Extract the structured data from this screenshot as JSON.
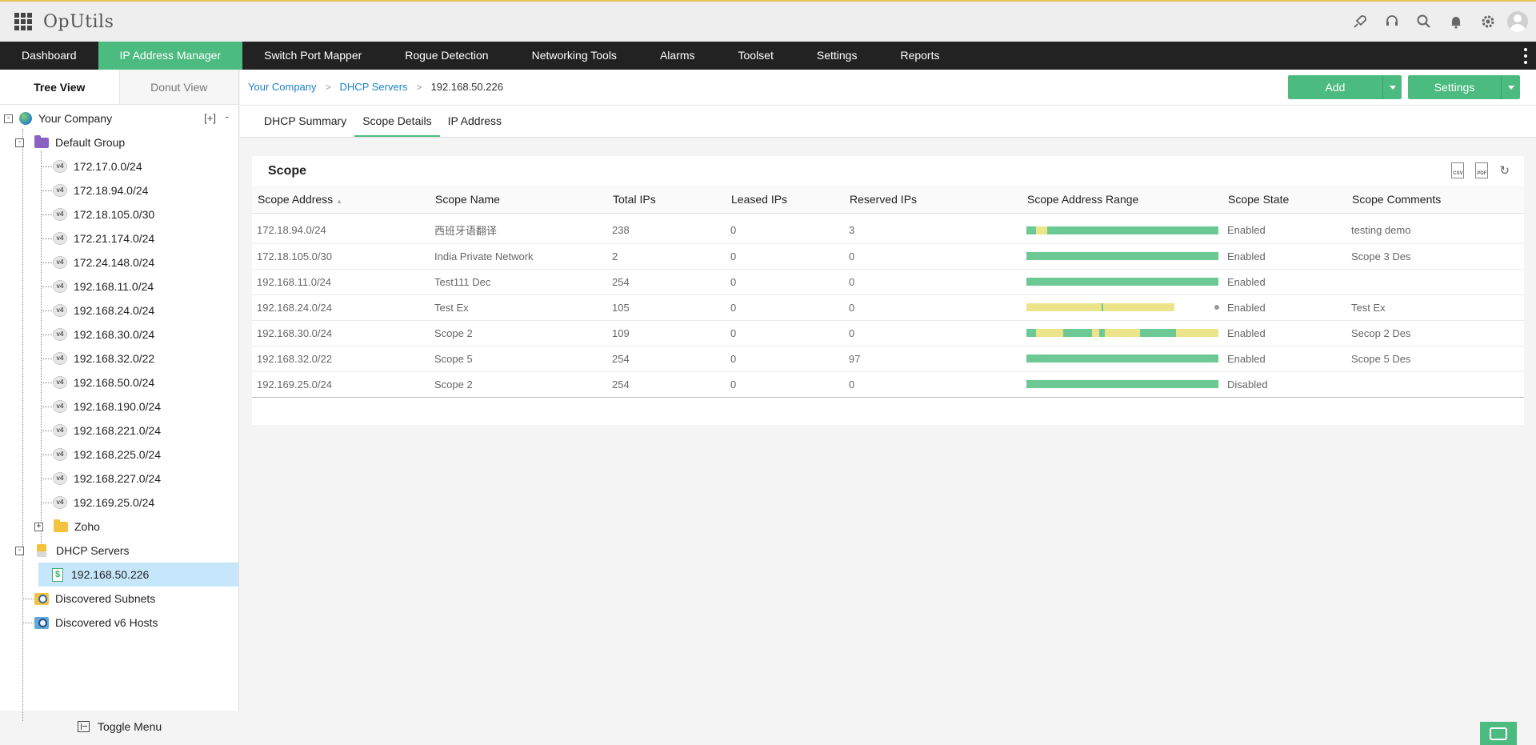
{
  "app": {
    "title": "OpUtils"
  },
  "nav": {
    "items": [
      {
        "label": "Dashboard"
      },
      {
        "label": "IP Address Manager"
      },
      {
        "label": "Switch Port Mapper"
      },
      {
        "label": "Rogue Detection"
      },
      {
        "label": "Networking Tools"
      },
      {
        "label": "Alarms"
      },
      {
        "label": "Toolset"
      },
      {
        "label": "Settings"
      },
      {
        "label": "Reports"
      }
    ],
    "active": "IP Address Manager"
  },
  "left_tabs": {
    "tree": "Tree View",
    "donut": "Donut View"
  },
  "tree": {
    "root": "Your Company",
    "add_label": "[+]",
    "collapse_label": "-",
    "default_group": "Default Group",
    "subnets": [
      "172.17.0.0/24",
      "172.18.94.0/24",
      "172.18.105.0/30",
      "172.21.174.0/24",
      "172.24.148.0/24",
      "192.168.11.0/24",
      "192.168.24.0/24",
      "192.168.30.0/24",
      "192.168.32.0/22",
      "192.168.50.0/24",
      "192.168.190.0/24",
      "192.168.221.0/24",
      "192.168.225.0/24",
      "192.168.227.0/24",
      "192.169.25.0/24"
    ],
    "v4_badge": "v4",
    "zoho": "Zoho",
    "dhcp_servers": "DHCP Servers",
    "dhcp_server_item": "192.168.50.226",
    "discovered_subnets": "Discovered Subnets",
    "discovered_v6": "Discovered v6 Hosts"
  },
  "toggle_menu": "Toggle Menu",
  "breadcrumb": {
    "root": "Your Company",
    "section": "DHCP Servers",
    "current": "192.168.50.226"
  },
  "actions": {
    "add": "Add",
    "settings": "Settings"
  },
  "content_tabs": {
    "summary": "DHCP Summary",
    "scope": "Scope Details",
    "ip": "IP Address"
  },
  "scope": {
    "title": "Scope",
    "icons": {
      "csv": "CSV",
      "pdf": "PDF"
    },
    "columns": {
      "address": "Scope Address",
      "name": "Scope Name",
      "total": "Total IPs",
      "leased": "Leased IPs",
      "reserved": "Reserved IPs",
      "range": "Scope Address Range",
      "state": "Scope State",
      "comments": "Scope Comments"
    },
    "rows": [
      {
        "address": "172.18.94.0/24",
        "name": "西班牙语翻译",
        "total": "238",
        "leased": "0",
        "reserved": "3",
        "state": "Enabled",
        "comments": "testing demo"
      },
      {
        "address": "172.18.105.0/30",
        "name": "India Private Network",
        "total": "2",
        "leased": "0",
        "reserved": "0",
        "state": "Enabled",
        "comments": "Scope 3 Des"
      },
      {
        "address": "192.168.11.0/24",
        "name": "Test111 Dec",
        "total": "254",
        "leased": "0",
        "reserved": "0",
        "state": "Enabled",
        "comments": ""
      },
      {
        "address": "192.168.24.0/24",
        "name": "Test Ex",
        "total": "105",
        "leased": "0",
        "reserved": "0",
        "state": "Enabled",
        "comments": "Test Ex"
      },
      {
        "address": "192.168.30.0/24",
        "name": "Scope 2",
        "total": "109",
        "leased": "0",
        "reserved": "0",
        "state": "Enabled",
        "comments": "Secop 2 Des"
      },
      {
        "address": "192.168.32.0/22",
        "name": "Scope 5",
        "total": "254",
        "leased": "0",
        "reserved": "97",
        "state": "Enabled",
        "comments": "Scope 5 Des"
      },
      {
        "address": "192.169.25.0/24",
        "name": "Scope 2",
        "total": "254",
        "leased": "0",
        "reserved": "0",
        "state": "Disabled",
        "comments": ""
      }
    ]
  },
  "colors": {
    "accent": "#4cbb7f",
    "range_green": "#6cc996",
    "range_yellow": "#ece48a",
    "disabled_state": "#ef5a5a",
    "link": "#1a83c6"
  }
}
